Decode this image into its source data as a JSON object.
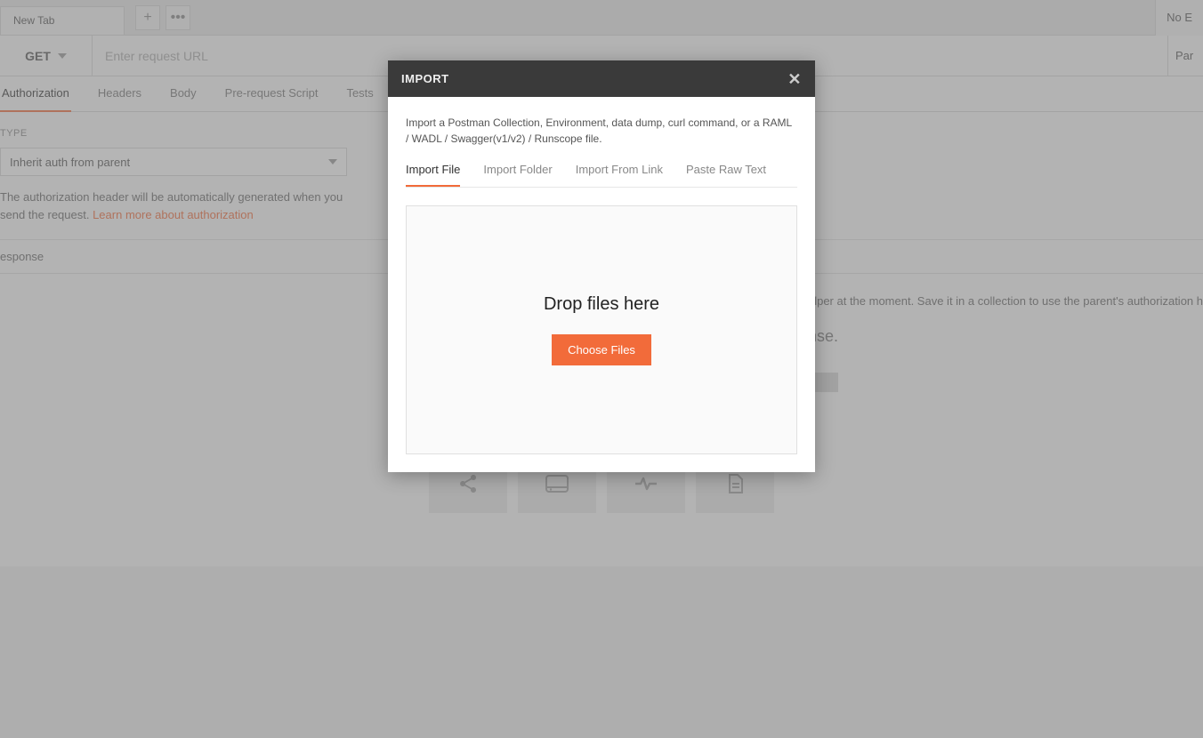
{
  "tabbar": {
    "tab_label": "New Tab",
    "right_label": "No E"
  },
  "request": {
    "method": "GET",
    "url_placeholder": "Enter request URL",
    "params_label": "Par"
  },
  "subtabs": {
    "auth": "Authorization",
    "headers": "Headers",
    "body": "Body",
    "prerequest": "Pre-request Script",
    "tests": "Tests"
  },
  "auth": {
    "type_label": "TYPE",
    "select_value": "Inherit auth from parent",
    "note_a": "The authorization header will be automatically generated when you send the request. ",
    "note_link": "Learn more about authorization",
    "right_note": "ion helper at the moment. Save it in a collection to use the parent's authorization h"
  },
  "response": {
    "header": "esponse",
    "message": "sponse."
  },
  "actions": {
    "share": "Share",
    "mock": "Mock",
    "monitor": "Monitor",
    "document": "Document"
  },
  "modal": {
    "title": "IMPORT",
    "desc": "Import a Postman Collection, Environment, data dump, curl command, or a RAML / WADL / Swagger(v1/v2) / Runscope file.",
    "tabs": {
      "file": "Import File",
      "folder": "Import Folder",
      "link": "Import From Link",
      "raw": "Paste Raw Text"
    },
    "dropzone_text": "Drop files here",
    "choose_files": "Choose Files"
  }
}
